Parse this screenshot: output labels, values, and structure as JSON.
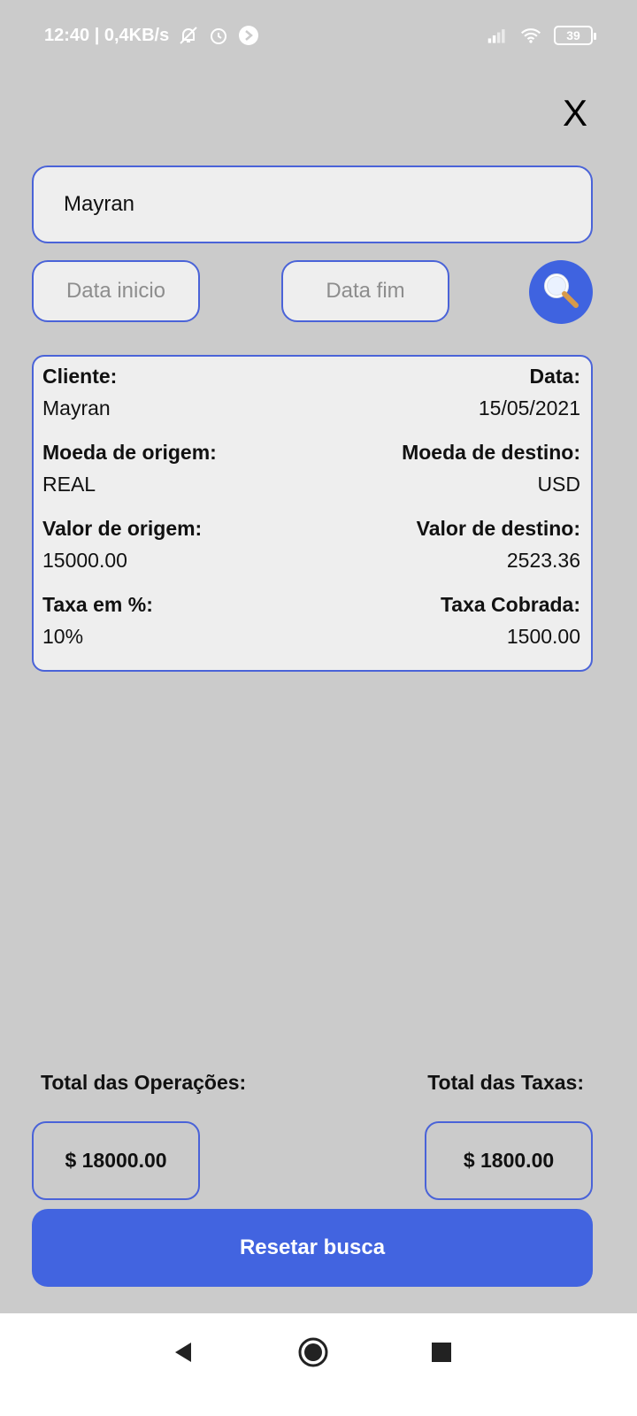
{
  "status_bar": {
    "time_speed": "12:40 | 0,4KB/s",
    "icons": [
      "muted-bell-icon",
      "alarm-icon",
      "app-notification-icon",
      "signal-icon",
      "wifi-icon"
    ],
    "battery": "39"
  },
  "close_label": "X",
  "search": {
    "client_value": "Mayran",
    "date_start_placeholder": "Data inicio",
    "date_end_placeholder": "Data fim"
  },
  "result": {
    "cliente_label": "Cliente:",
    "cliente_value": "Mayran",
    "data_label": "Data:",
    "data_value": "15/05/2021",
    "moeda_origem_label": "Moeda de origem:",
    "moeda_origem_value": "REAL",
    "moeda_destino_label": "Moeda de destino:",
    "moeda_destino_value": "USD",
    "valor_origem_label": "Valor de origem:",
    "valor_origem_value": "15000.00",
    "valor_destino_label": "Valor de destino:",
    "valor_destino_value": "2523.36",
    "taxa_label": "Taxa em %:",
    "taxa_value": "10%",
    "taxa_cobrada_label": "Taxa Cobrada:",
    "taxa_cobrada_value": "1500.00"
  },
  "totals": {
    "operacoes_label": "Total das Operações:",
    "operacoes_value": "$ 18000.00",
    "taxas_label": "Total das Taxas:",
    "taxas_value": "$ 1800.00"
  },
  "reset_label": "Resetar busca",
  "colors": {
    "background": "#cbcbcb",
    "accent": "#4264e0",
    "card": "#eeeeee"
  }
}
